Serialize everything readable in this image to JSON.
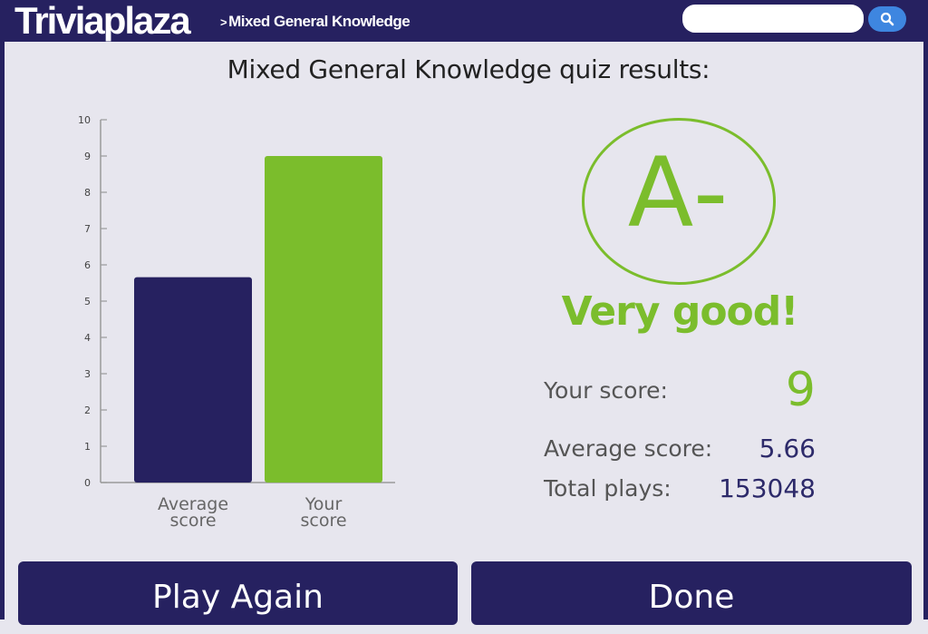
{
  "header": {
    "logo": "Triviaplaza",
    "breadcrumb_sep": ">",
    "breadcrumb": "Mixed General Knowledge",
    "search": {
      "value": "",
      "placeholder": ""
    }
  },
  "title": "Mixed General Knowledge quiz results:",
  "chart_data": {
    "type": "bar",
    "categories": [
      "Average\nscore",
      "Your\nscore"
    ],
    "values": [
      5.66,
      9
    ],
    "colors": [
      "#262160",
      "#7bbd2c"
    ],
    "ylim": [
      0,
      10
    ],
    "yticks": [
      0,
      1,
      2,
      3,
      4,
      5,
      6,
      7,
      8,
      9,
      10
    ],
    "title": "",
    "xlabel": "",
    "ylabel": "",
    "grid": false
  },
  "result": {
    "grade": "A-",
    "verdict": "Very good!",
    "your_score_label": "Your score:",
    "your_score": "9",
    "average_label": "Average score:",
    "average": "5.66",
    "plays_label": "Total plays:",
    "plays": "153048"
  },
  "buttons": {
    "play_again": "Play Again",
    "done": "Done"
  },
  "colors": {
    "primary": "#262160",
    "accent": "#7bbd2c",
    "search": "#3e86e0",
    "background": "#e7e6ee"
  }
}
